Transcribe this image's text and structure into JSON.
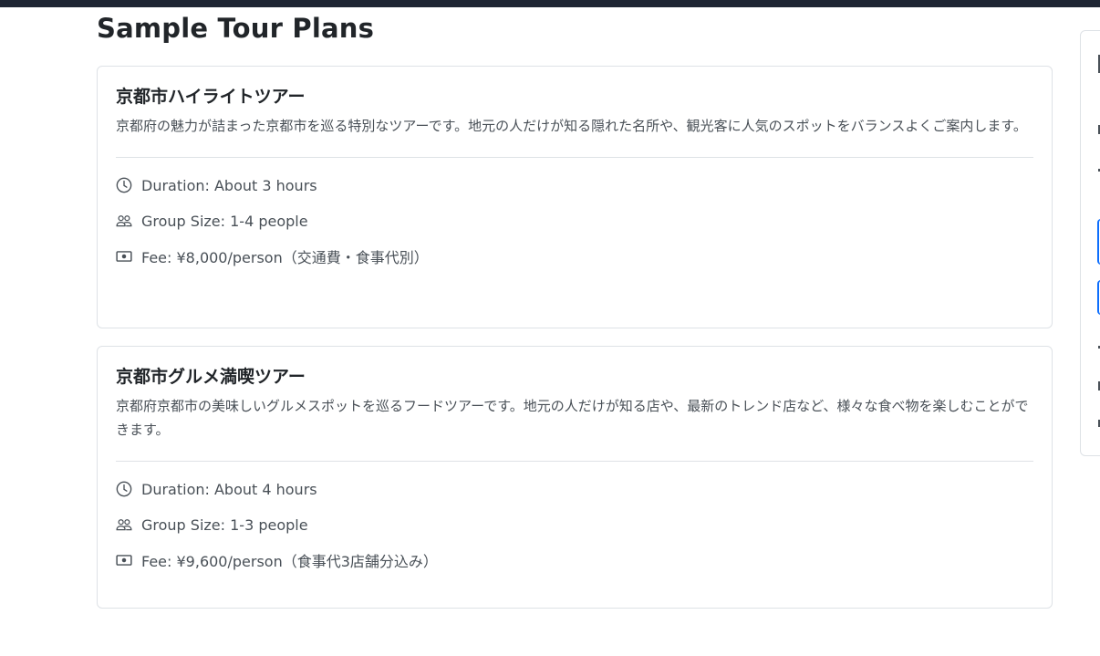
{
  "section_title": "Sample Tour Plans",
  "tours": [
    {
      "title": "京都市ハイライトツアー",
      "description": "京都府の魅力が詰まった京都市を巡る特別なツアーです。地元の人だけが知る隠れた名所や、観光客に人気のスポットをバランスよくご案内します。",
      "duration": "Duration: About 3 hours",
      "group_size": "Group Size: 1-4 people",
      "fee": "Fee: ¥8,000/person（交通費・食事代別）"
    },
    {
      "title": "京都市グルメ満喫ツアー",
      "description": "京都府京都市の美味しいグルメスポットを巡るフードツアーです。地元の人だけが知る店や、最新のトレンド店など、様々な食べ物を楽しむことができます。",
      "duration": "Duration: About 4 hours",
      "group_size": "Group Size: 1-3 people",
      "fee": "Fee: ¥9,600/person（食事代3店舗分込み）"
    }
  ],
  "icons": {
    "duration": "clock-icon",
    "group_size": "people-icon",
    "fee": "cash-icon"
  },
  "colors": {
    "top_bar": "#1e2533",
    "border": "#dee2e6",
    "text": "#212529",
    "muted_text": "#495057",
    "accent": "#0d6efd"
  }
}
